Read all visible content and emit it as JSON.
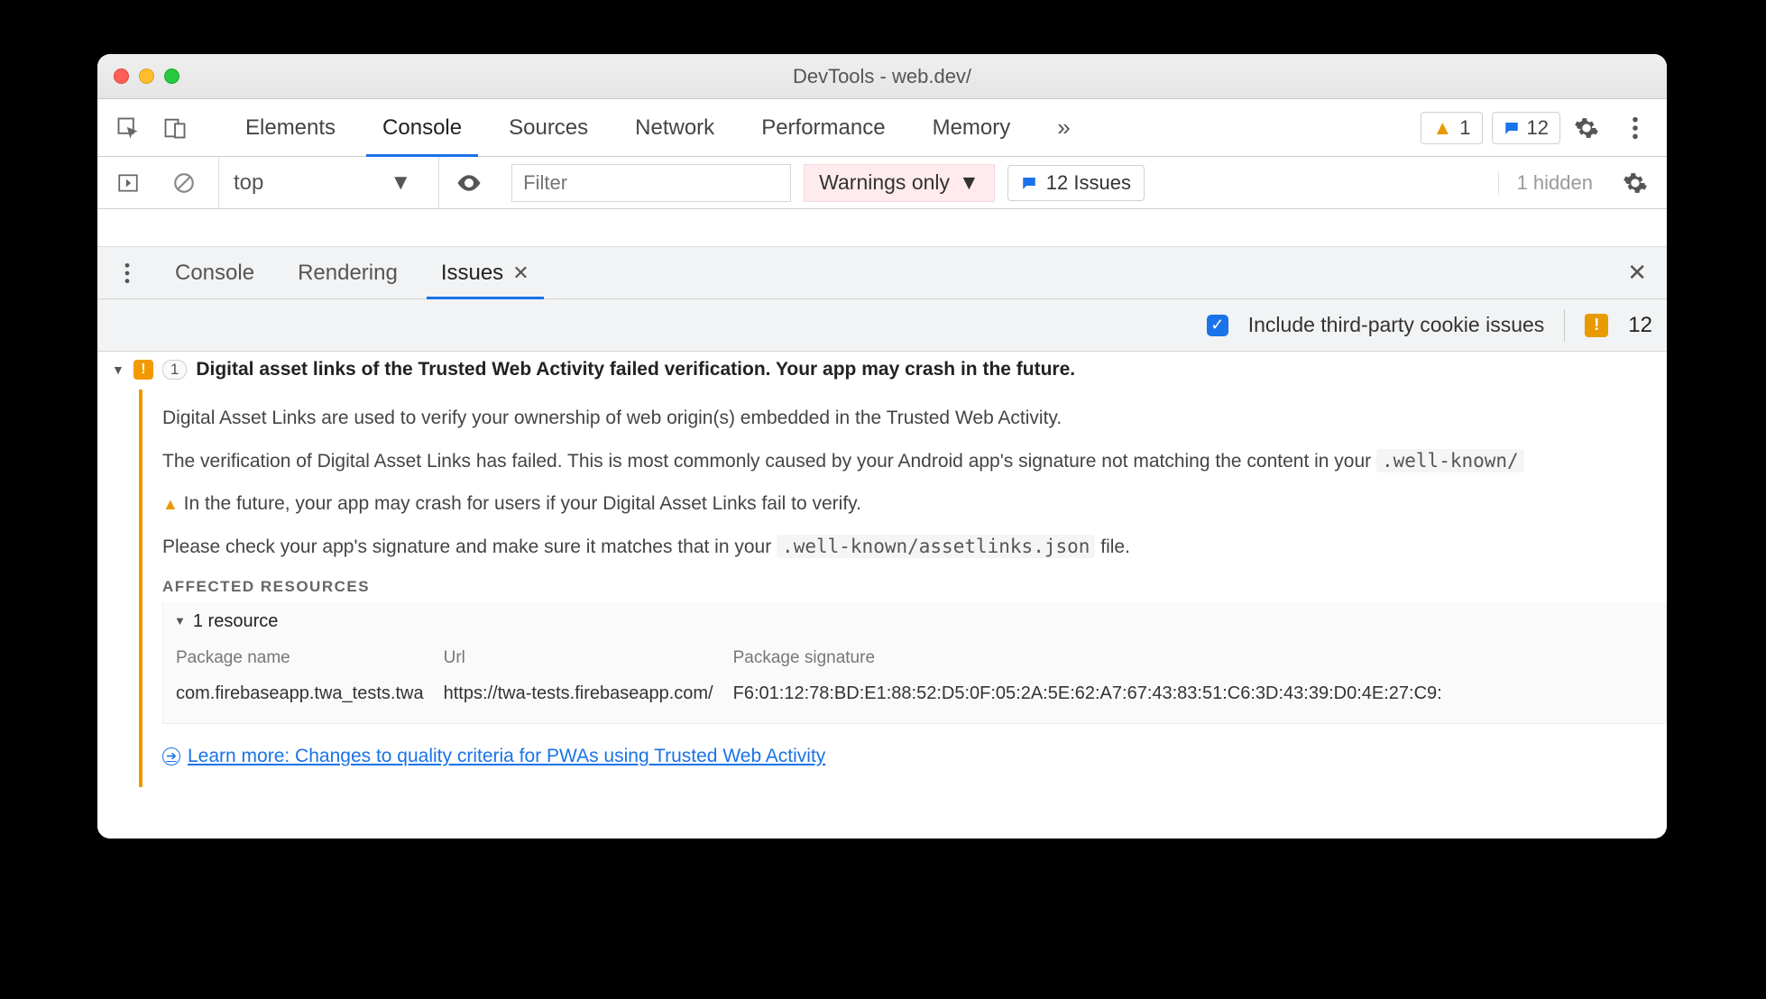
{
  "window": {
    "title": "DevTools - web.dev/"
  },
  "main_tabs": {
    "items": [
      "Elements",
      "Console",
      "Sources",
      "Network",
      "Performance",
      "Memory"
    ],
    "active_index": 1
  },
  "badges": {
    "warnings": "1",
    "messages": "12"
  },
  "toolbar2": {
    "context": "top",
    "filter_placeholder": "Filter",
    "level": "Warnings only",
    "issues_label": "12 Issues",
    "hidden": "1 hidden"
  },
  "drawer_tabs": {
    "items": [
      "Console",
      "Rendering",
      "Issues"
    ],
    "active_index": 2
  },
  "drawer_toolbar": {
    "include_label": "Include third-party cookie issues",
    "issue_count": "12"
  },
  "issue": {
    "count": "1",
    "title": "Digital asset links of the Trusted Web Activity failed verification. Your app may crash in the future.",
    "p1": "Digital Asset Links are used to verify your ownership of web origin(s) embedded in the Trusted Web Activity.",
    "p2a": "The verification of Digital Asset Links has failed. This is most commonly caused by your Android app's signature not matching the content in your ",
    "p2_code": ".well-known/",
    "p3": "In the future, your app may crash for users if your Digital Asset Links fail to verify.",
    "p4a": "Please check your app's signature and make sure it matches that in your ",
    "p4_code": ".well-known/assetlinks.json",
    "p4b": " file.",
    "affected_heading": "AFFECTED RESOURCES",
    "resource_toggle": "1 resource",
    "cols": {
      "pkg": "Package name",
      "url": "Url",
      "sig": "Package signature"
    },
    "row": {
      "pkg": "com.firebaseapp.twa_tests.twa",
      "url": "https://twa-tests.firebaseapp.com/",
      "sig": "F6:01:12:78:BD:E1:88:52:D5:0F:05:2A:5E:62:A7:67:43:83:51:C6:3D:43:39:D0:4E:27:C9:"
    },
    "learn_more": "Learn more: Changes to quality criteria for PWAs using Trusted Web Activity"
  }
}
